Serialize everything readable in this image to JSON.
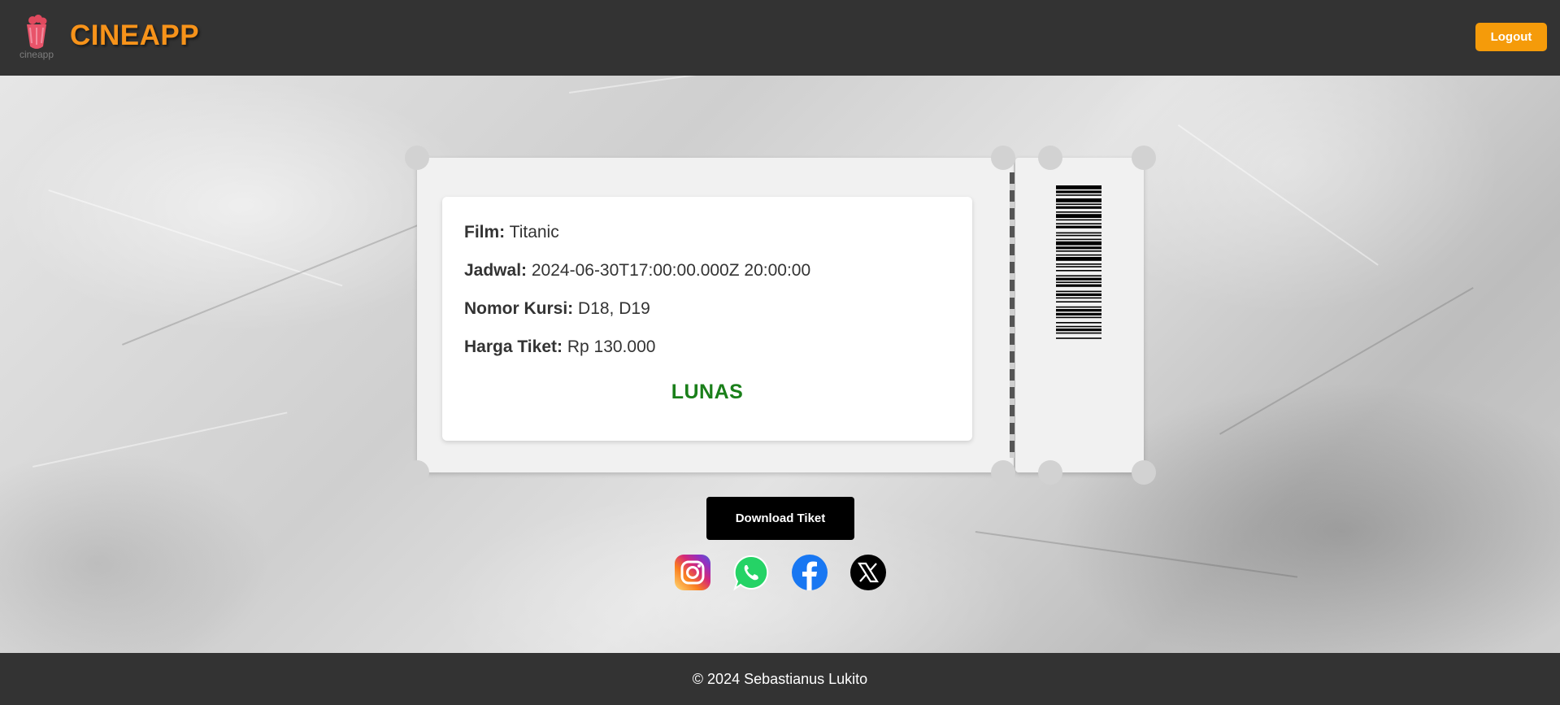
{
  "header": {
    "brand": "CINEAPP",
    "logo_caption": "cineapp",
    "logout_label": "Logout"
  },
  "ticket": {
    "film_label": "Film:",
    "film_value": "Titanic",
    "schedule_label": "Jadwal:",
    "schedule_value": "2024-06-30T17:00:00.000Z 20:00:00",
    "seat_label": "Nomor Kursi:",
    "seat_value": "D18, D19",
    "price_label": "Harga Tiket:",
    "price_value": "Rp 130.000",
    "status": "LUNAS"
  },
  "actions": {
    "download_label": "Download Tiket"
  },
  "social_icons": [
    "instagram-icon",
    "whatsapp-icon",
    "facebook-icon",
    "x-icon"
  ],
  "footer": {
    "text": "© 2024 Sebastianus Lukito"
  },
  "colors": {
    "header_bg": "#333333",
    "brand": "#f7931a",
    "logout_bg": "#f59b0a",
    "status_green": "#1a7f1a",
    "download_bg": "#000000"
  }
}
